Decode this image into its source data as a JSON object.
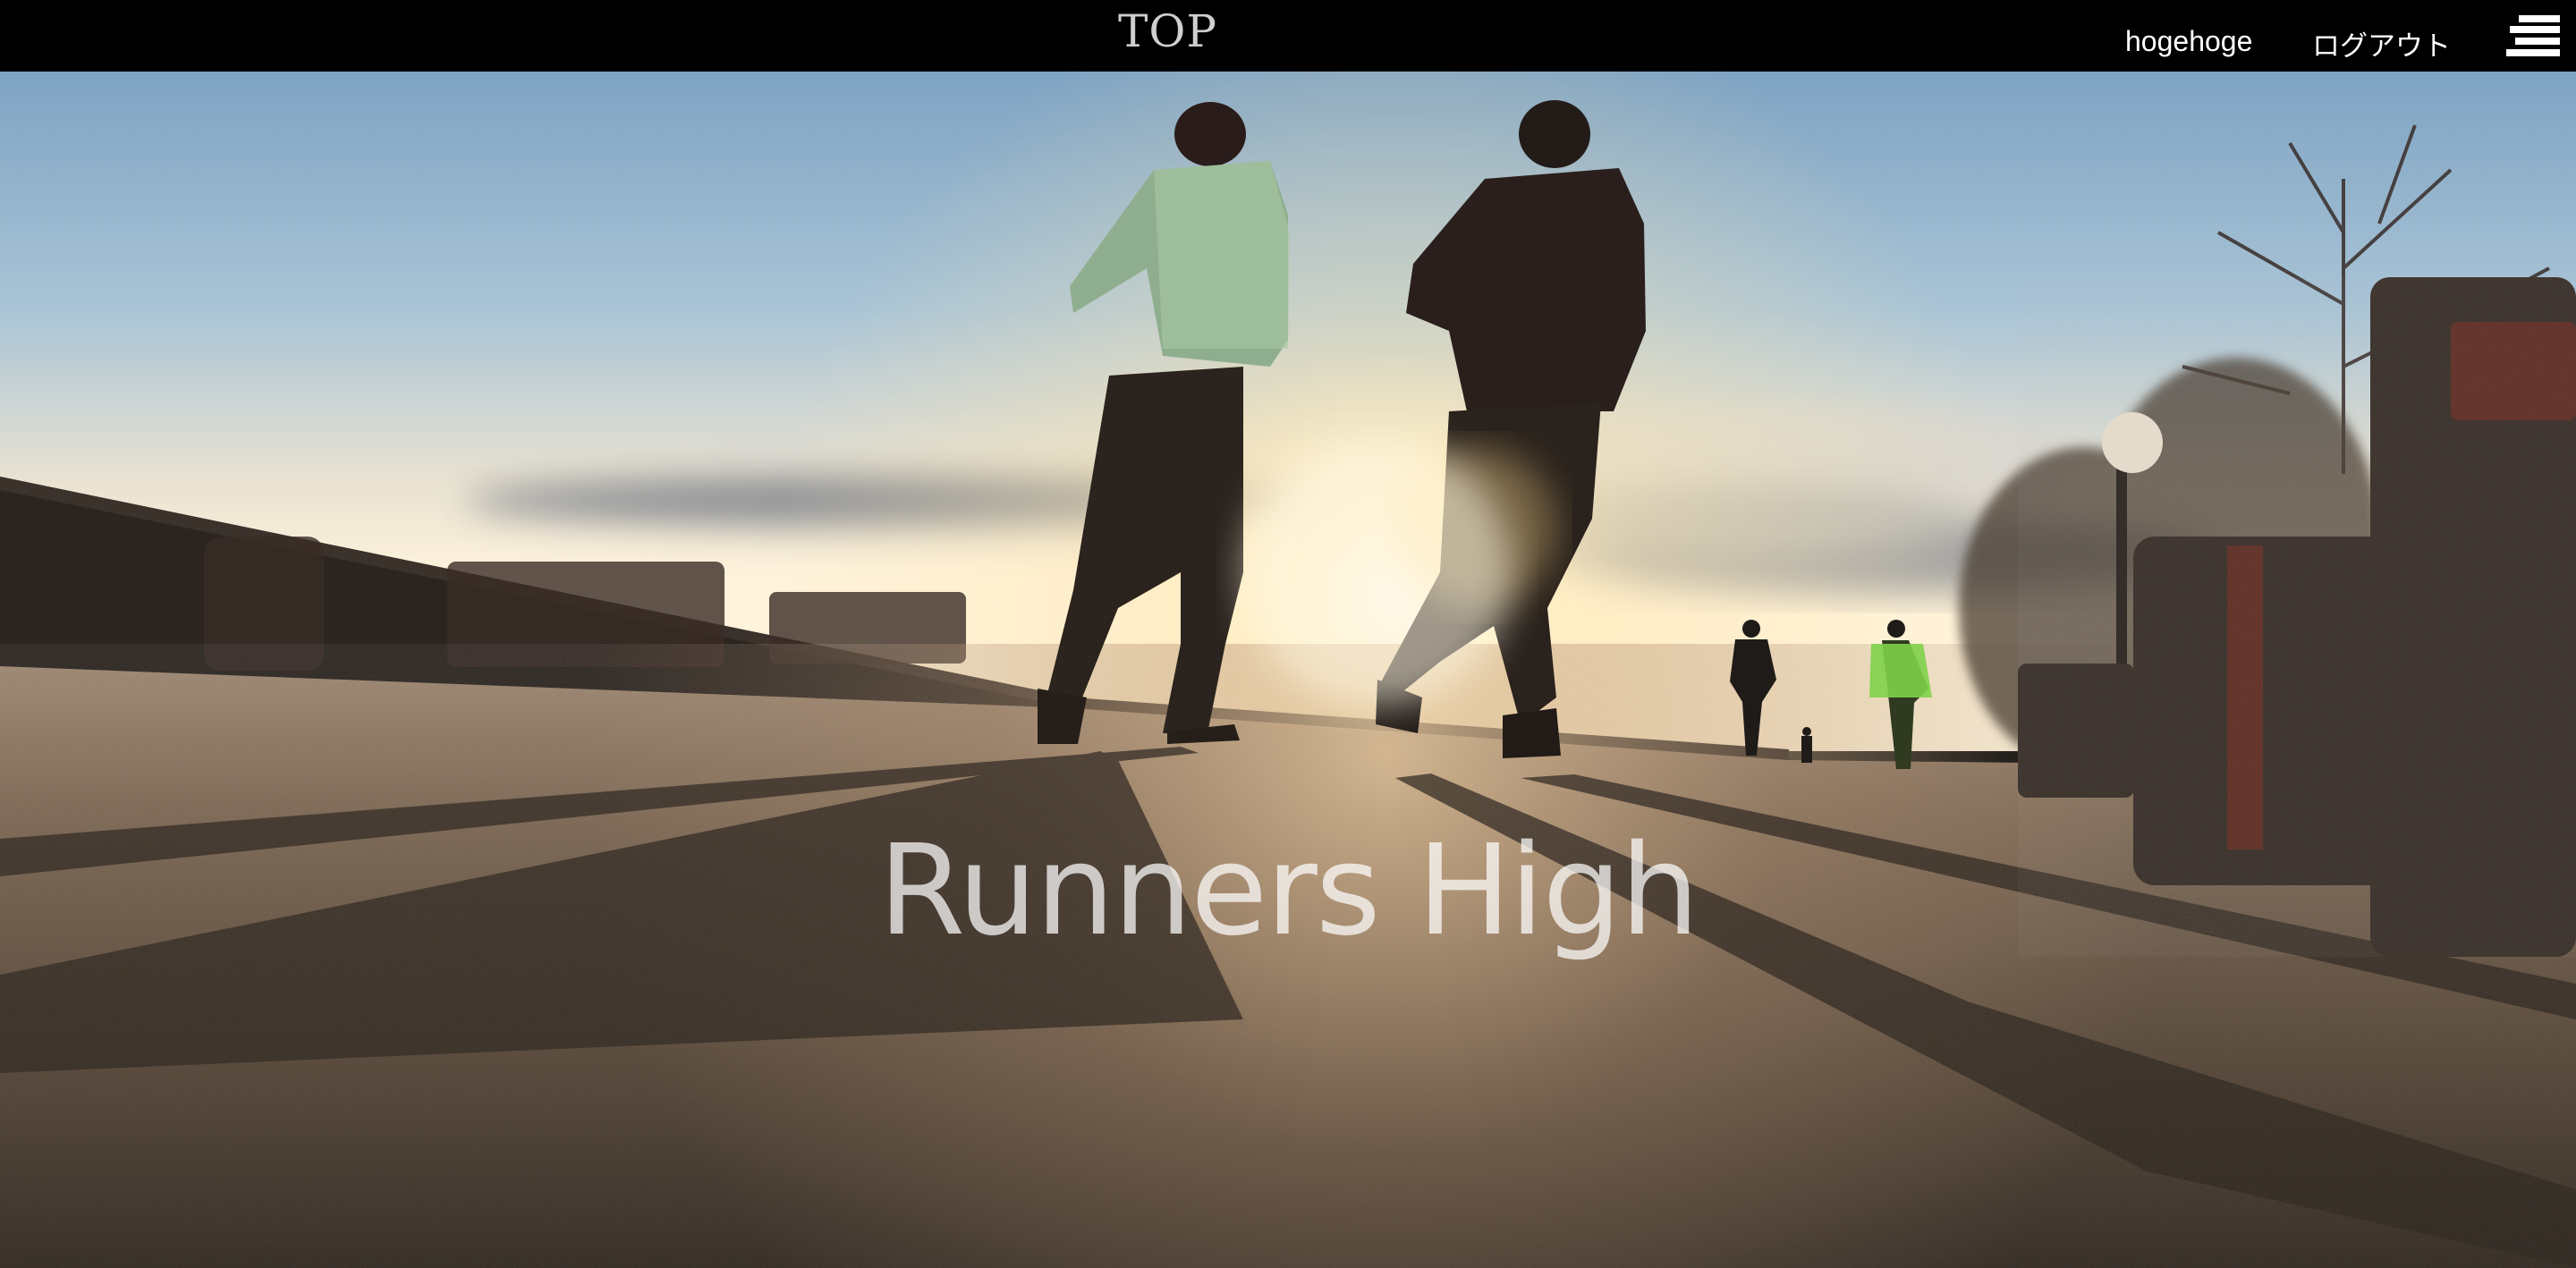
{
  "header": {
    "title": "TOP",
    "username": "hogehoge",
    "logout_label": "ログアウト",
    "menu_icon": "hamburger-menu-icon"
  },
  "hero": {
    "title": "Runners High",
    "image": "runners-at-sunset-photo"
  },
  "colors": {
    "header_bg": "#000000",
    "header_text": "#ffffff",
    "sky_top": "#7fa4c4",
    "sun_glow": "#fff4d6",
    "ground": "#5a4a3a"
  }
}
